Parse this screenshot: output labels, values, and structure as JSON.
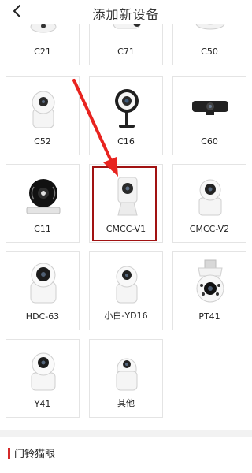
{
  "header": {
    "title": "添加新设备",
    "back_icon": "chevron-left-icon"
  },
  "devices": [
    {
      "label": "C21",
      "icon": "ceiling-camera-icon"
    },
    {
      "label": "C71",
      "icon": "bullet-camera-icon"
    },
    {
      "label": "C50",
      "icon": "dome-camera-icon"
    },
    {
      "label": "C52",
      "icon": "pan-tilt-camera-icon"
    },
    {
      "label": "C16",
      "icon": "stand-camera-icon"
    },
    {
      "label": "C60",
      "icon": "webcam-bar-icon"
    },
    {
      "label": "C11",
      "icon": "round-camera-icon"
    },
    {
      "label": "CMCC-V1",
      "icon": "cube-camera-icon"
    },
    {
      "label": "CMCC-V2",
      "icon": "pan-tilt-camera-icon"
    },
    {
      "label": "HDC-63",
      "icon": "pan-tilt-camera-icon"
    },
    {
      "label": "小白-YD16",
      "icon": "pan-tilt-camera-icon"
    },
    {
      "label": "PT41",
      "icon": "outdoor-bulb-camera-icon"
    },
    {
      "label": "Y41",
      "icon": "pan-tilt-camera-icon"
    },
    {
      "label": "其他",
      "icon": "pan-tilt-camera-icon"
    }
  ],
  "highlighted_device": "CMCC-V1",
  "annotation": {
    "arrow_color": "#e8231f",
    "box_color": "#a11212"
  },
  "section": {
    "title": "门铃猫眼",
    "accent_color": "#d42a2a"
  }
}
